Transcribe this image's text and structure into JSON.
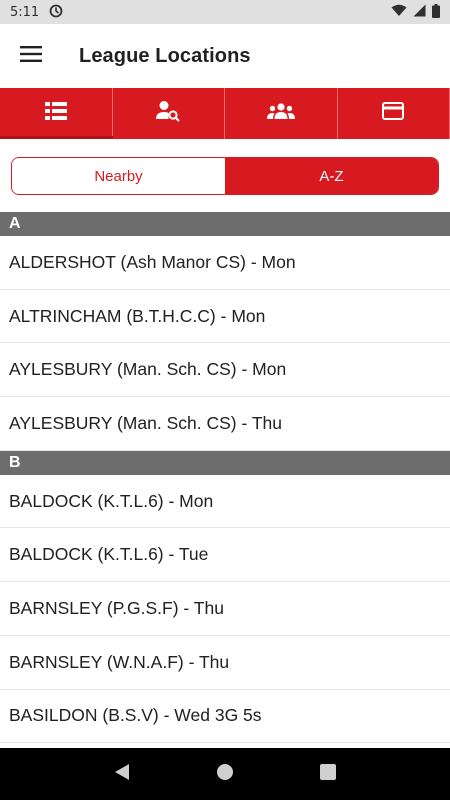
{
  "status_bar": {
    "time": "5:11",
    "icons": [
      "sync-icon",
      "wifi-icon",
      "signal-icon",
      "battery-icon"
    ]
  },
  "app_bar": {
    "title": "League Locations",
    "menu_icon": "hamburger-menu-icon"
  },
  "tabs": [
    {
      "icon": "list-icon",
      "selected": true
    },
    {
      "icon": "person-search-icon",
      "selected": false
    },
    {
      "icon": "group-icon",
      "selected": false
    },
    {
      "icon": "card-icon",
      "selected": false
    }
  ],
  "segment": {
    "nearby_label": "Nearby",
    "az_label": "A-Z",
    "selected": "A-Z"
  },
  "sections": [
    {
      "letter": "A",
      "items": [
        "ALDERSHOT (Ash Manor CS) - Mon",
        "ALTRINCHAM (B.T.H.C.C) - Mon",
        "AYLESBURY (Man. Sch. CS) - Mon",
        "AYLESBURY (Man. Sch. CS) - Thu"
      ]
    },
    {
      "letter": "B",
      "items": [
        "BALDOCK (K.T.L.6) - Mon",
        "BALDOCK (K.T.L.6) - Tue",
        "BARNSLEY (P.G.S.F) - Thu",
        "BARNSLEY (W.N.A.F) - Thu",
        "BASILDON (B.S.V) - Wed 3G 5s"
      ]
    }
  ],
  "colors": {
    "accent": "#d71920",
    "section_header": "#6d6d6d",
    "status_bar": "#e0e0e0"
  }
}
